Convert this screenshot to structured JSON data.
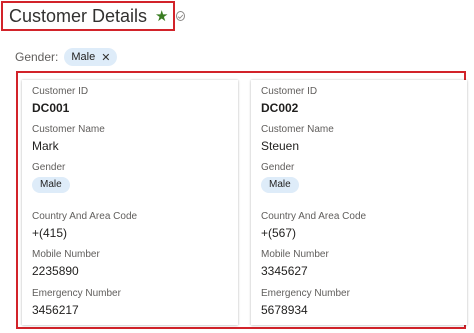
{
  "header": {
    "title": "Customer Details",
    "star_icon": "star-icon",
    "check_icon": "check-circle-icon",
    "accent": "#3a7d22"
  },
  "filter": {
    "label": "Gender:",
    "chip_value": "Male"
  },
  "cards": [
    {
      "customer_id_label": "Customer ID",
      "customer_id": "DC001",
      "customer_name_label": "Customer Name",
      "customer_name": "Mark",
      "gender_label": "Gender",
      "gender": "Male",
      "country_label": "Country And Area Code",
      "country": "+(415)",
      "mobile_label": "Mobile Number",
      "mobile": "2235890",
      "emergency_label": "Emergency Number",
      "emergency": "3456217"
    },
    {
      "customer_id_label": "Customer ID",
      "customer_id": "DC002",
      "customer_name_label": "Customer Name",
      "customer_name": "Steuen",
      "gender_label": "Gender",
      "gender": "Male",
      "country_label": "Country And Area Code",
      "country": "+(567)",
      "mobile_label": "Mobile Number",
      "mobile": "3345627",
      "emergency_label": "Emergency Number",
      "emergency": "5678934"
    }
  ]
}
